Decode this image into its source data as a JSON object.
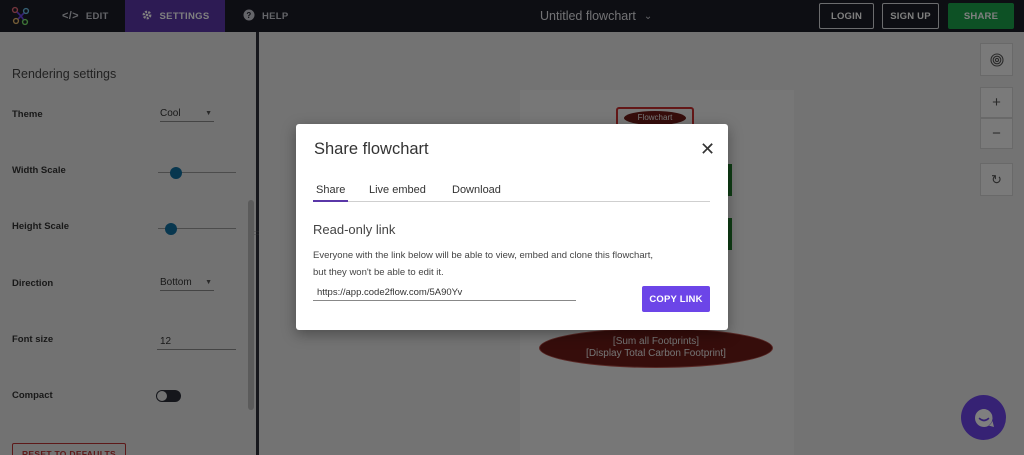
{
  "topbar": {
    "tabs": {
      "edit": "EDIT",
      "settings": "SETTINGS",
      "help": "HELP"
    },
    "title": "Untitled flowchart",
    "login": "LOGIN",
    "signup": "SIGN UP",
    "share": "SHARE",
    "accent": "#5a37a8",
    "share_color": "#1aa34a"
  },
  "sidebar": {
    "heading": "Rendering settings",
    "theme": {
      "label": "Theme",
      "value": "Cool"
    },
    "width_scale": {
      "label": "Width Scale",
      "fraction": 0.18
    },
    "height_scale": {
      "label": "Height Scale",
      "fraction": 0.1
    },
    "direction": {
      "label": "Direction",
      "value": "Bottom"
    },
    "font_size": {
      "label": "Font size",
      "value": "12"
    },
    "compact": {
      "label": "Compact",
      "on": false
    },
    "reset_button": "RESET TO DEFAULTS"
  },
  "canvas": {
    "start_node": "Flowchart",
    "end_node": {
      "line1": "[Sum all Footprints]",
      "line2": "[Display Total Carbon Footprint]"
    },
    "controls": [
      "fingerprint-icon",
      "zoom-in-icon",
      "zoom-out-icon",
      "reset-view-icon"
    ]
  },
  "modal": {
    "title": "Share flowchart",
    "tabs": [
      "Share",
      "Live embed",
      "Download"
    ],
    "active_tab": "Share",
    "section_title": "Read-only link",
    "desc_line1": "Everyone with the link below will be able to view, embed and clone this flowchart,",
    "desc_line2": "but they won't be able to edit it.",
    "link": "https://app.code2flow.com/5A90Yv",
    "copy_button": "COPY LINK",
    "button_color": "#6c45e8"
  }
}
